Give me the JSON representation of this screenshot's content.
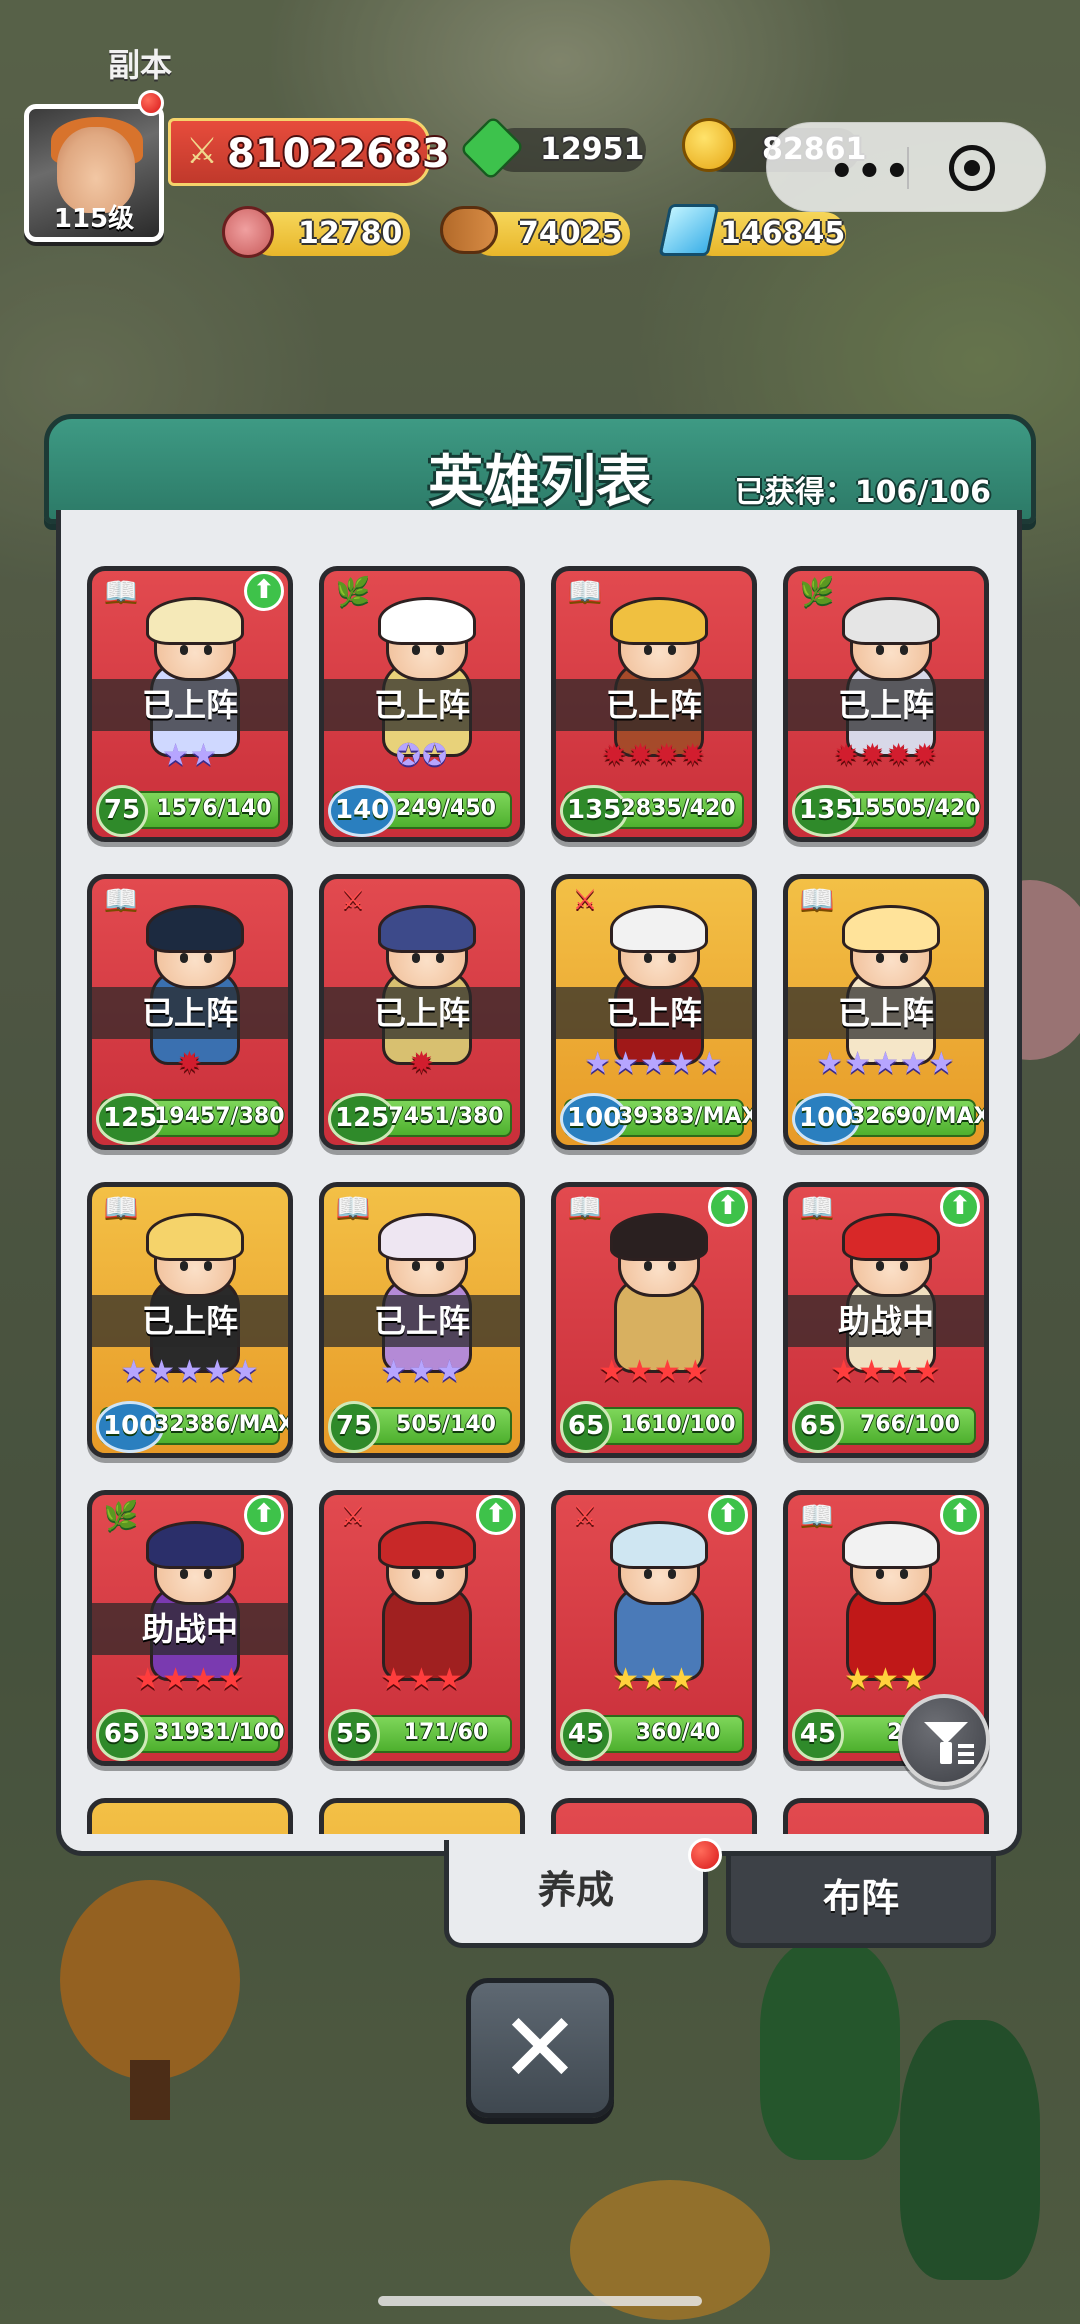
{
  "hud": {
    "dungeon_label": "副本",
    "avatar_level": "115级",
    "power": "81022683",
    "gems": "12951",
    "coins": "82861",
    "meat": "12780",
    "wood": "74025",
    "crystal": "146845",
    "capsule_dots": "•••"
  },
  "panel": {
    "title": "英雄列表",
    "count_label": "已获得：106/106"
  },
  "heroes": [
    {
      "class_icon": "📖",
      "status": "已上阵",
      "stars": "★★",
      "level": "75",
      "progress": "1576/140"
    },
    {
      "class_icon": "🌿",
      "status": "已上阵",
      "stars": "✪✪",
      "level": "140",
      "progress": "249/450"
    },
    {
      "class_icon": "📖",
      "status": "已上阵",
      "stars": "✹✹✹✹",
      "level": "135",
      "progress": "2835/420"
    },
    {
      "class_icon": "🌿",
      "status": "已上阵",
      "stars": "✹✹✹✹",
      "level": "135",
      "progress": "15505/420"
    },
    {
      "class_icon": "📖",
      "status": "已上阵",
      "stars": "✹",
      "level": "125",
      "progress": "19457/380"
    },
    {
      "class_icon": "⚔",
      "status": "已上阵",
      "stars": "✹",
      "level": "125",
      "progress": "7451/380"
    },
    {
      "class_icon": "⚔",
      "status": "已上阵",
      "stars": "★★★★★",
      "level": "100",
      "progress": "39383/MAX"
    },
    {
      "class_icon": "📖",
      "status": "已上阵",
      "stars": "★★★★★",
      "level": "100",
      "progress": "32690/MAX"
    },
    {
      "class_icon": "📖",
      "status": "已上阵",
      "stars": "★★★★★",
      "level": "100",
      "progress": "32386/MAX"
    },
    {
      "class_icon": "📖",
      "status": "已上阵",
      "stars": "★★★",
      "level": "75",
      "progress": "505/140"
    },
    {
      "class_icon": "📖",
      "status": "",
      "stars": "★★★★",
      "level": "65",
      "progress": "1610/100"
    },
    {
      "class_icon": "📖",
      "status": "助战中",
      "stars": "★★★★",
      "level": "65",
      "progress": "766/100"
    },
    {
      "class_icon": "🌿",
      "status": "助战中",
      "stars": "★★★★",
      "level": "65",
      "progress": "31931/100"
    },
    {
      "class_icon": "⚔",
      "status": "",
      "stars": "★★★",
      "level": "55",
      "progress": "171/60"
    },
    {
      "class_icon": "⚔",
      "status": "",
      "stars": "★★★",
      "level": "45",
      "progress": "360/40"
    },
    {
      "class_icon": "📖",
      "status": "",
      "stars": "★★★",
      "level": "45",
      "progress": "250"
    }
  ],
  "tabs": {
    "develop": "养成",
    "formation": "布阵"
  },
  "close_label": "✕"
}
